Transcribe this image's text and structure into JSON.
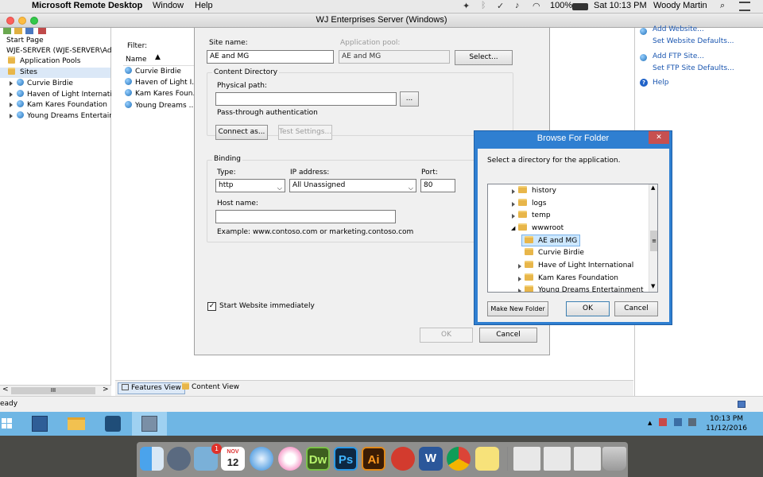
{
  "menubar": {
    "app_name": "Microsoft Remote Desktop",
    "menu_window": "Window",
    "menu_help": "Help",
    "battery": "100%",
    "datetime": "Sat 10:13 PM",
    "user": "Woody Martin"
  },
  "window": {
    "title": "WJ Enterprises Server (Windows)"
  },
  "tree": {
    "start_page": "Start Page",
    "server": "WJE-SERVER (WJE-SERVER\\Admir",
    "app_pools": "Application Pools",
    "sites": "Sites",
    "site_items": [
      "Curvie Birdie",
      "Haven of Light Internation",
      "Kam Kares Foundation",
      "Young Dreams Entertainm"
    ],
    "scroll_grip": "III"
  },
  "center": {
    "filter_label": "Filter:",
    "name_header": "Name",
    "site_items": [
      "Curvie Birdie",
      "Haven of Light I...",
      "Kam Kares Foun...",
      "Young Dreams ..."
    ],
    "features_view": "Features View",
    "content_view": "Content View"
  },
  "actions": {
    "add_website": "Add Website...",
    "set_website_defaults": "Set Website Defaults...",
    "add_ftp_site": "Add FTP Site...",
    "set_ftp_defaults": "Set FTP Site Defaults...",
    "help": "Help"
  },
  "status": {
    "text": "eady"
  },
  "add_site_dialog": {
    "site_name_label": "Site name:",
    "site_name_value": "AE and MG",
    "app_pool_label": "Application pool:",
    "app_pool_value": "AE and MG",
    "select_button": "Select...",
    "content_directory_label": "Content Directory",
    "physical_path_label": "Physical path:",
    "physical_path_value": "",
    "browse_button": "...",
    "pass_through_label": "Pass-through authentication",
    "connect_as_button": "Connect as...",
    "test_settings_button": "Test Settings...",
    "binding_label": "Binding",
    "type_label": "Type:",
    "type_value": "http",
    "ip_label": "IP address:",
    "ip_value": "All Unassigned",
    "port_label": "Port:",
    "port_value": "80",
    "host_name_label": "Host name:",
    "host_name_value": "",
    "example_text": "Example: www.contoso.com or marketing.contoso.com",
    "start_immediately_label": "Start Website immediately",
    "start_immediately_checked": true,
    "ok_button": "OK",
    "cancel_button": "Cancel"
  },
  "browse_dialog": {
    "title": "Browse For Folder",
    "close_glyph": "✕",
    "instruction": "Select a directory for the application.",
    "folders": [
      "history",
      "logs",
      "temp",
      "wwwroot",
      "AE and MG",
      "Curvie Birdie",
      "Have of Light International",
      "Kam Kares Foundation",
      "Young Dreams Entertainment"
    ],
    "selected_folder": "AE and MG",
    "make_new_folder_button": "Make New Folder",
    "ok_button": "OK",
    "cancel_button": "Cancel"
  },
  "taskbar": {
    "time": "10:13 PM",
    "date": "11/12/2016"
  },
  "dock": {
    "calendar_month": "NOV",
    "calendar_day": "12",
    "dreamweaver": "Dw",
    "photoshop": "Ps",
    "illustrator": "Ai",
    "word": "W",
    "notification_badge": "1"
  }
}
